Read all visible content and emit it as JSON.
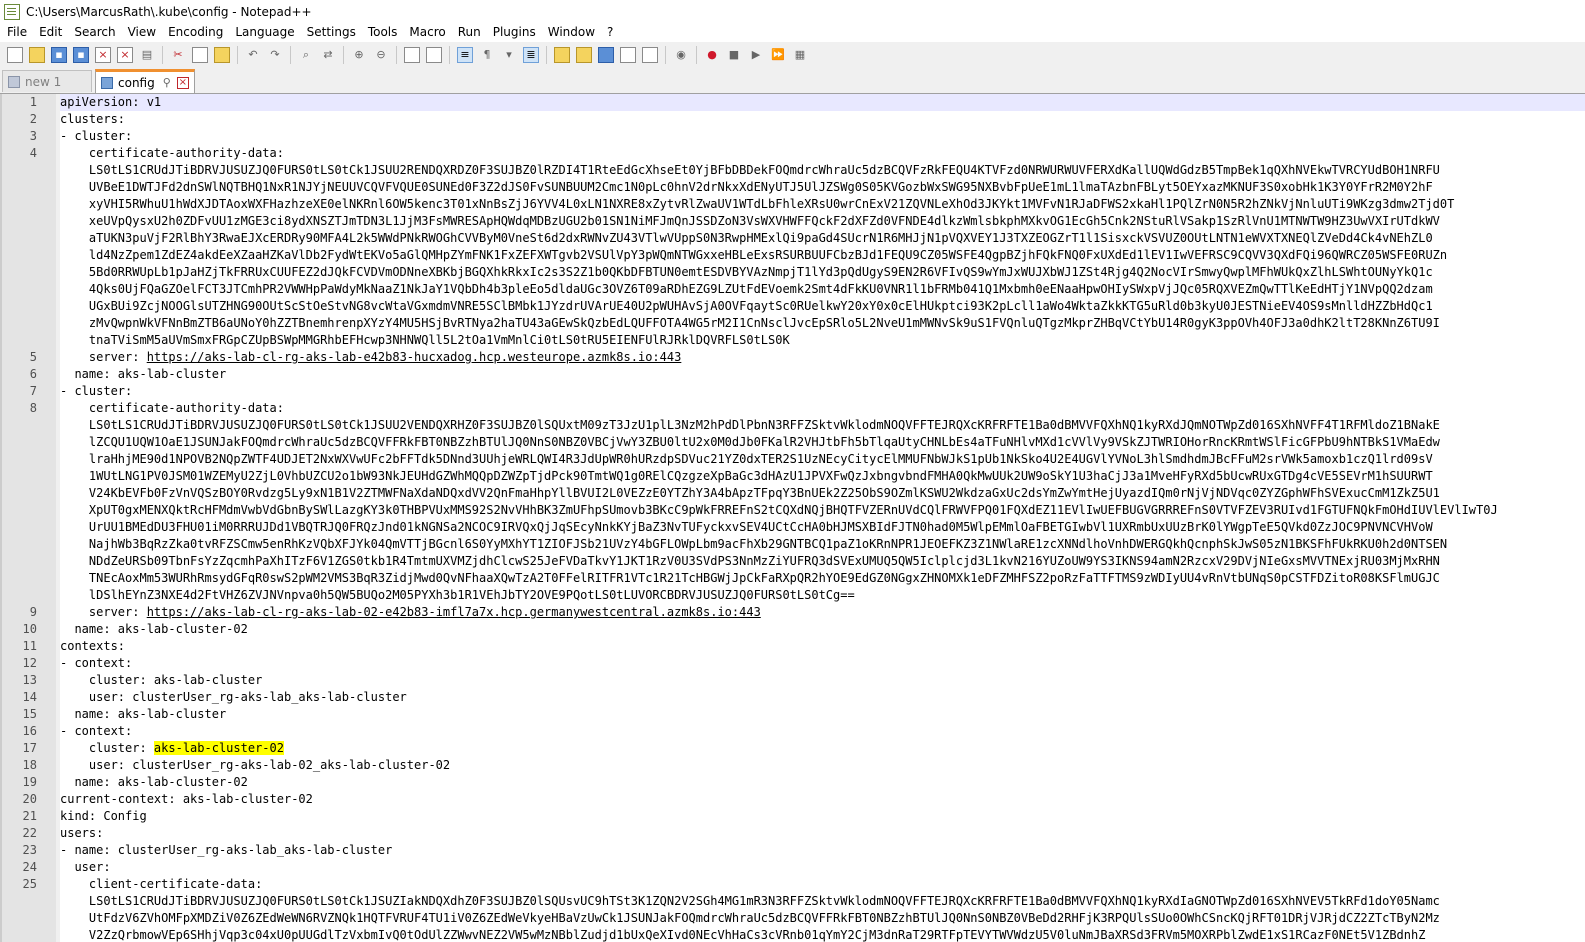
{
  "window": {
    "title": "C:\\Users\\MarcusRath\\.kube\\config - Notepad++"
  },
  "menu": [
    "File",
    "Edit",
    "Search",
    "View",
    "Encoding",
    "Language",
    "Settings",
    "Tools",
    "Macro",
    "Run",
    "Plugins",
    "Window",
    "?"
  ],
  "toolbar": {
    "icons": [
      "new-file-icon",
      "open-file-icon",
      "save-icon",
      "save-all-icon",
      "close-icon",
      "close-all-icon",
      "print-icon",
      "cut-icon",
      "copy-icon",
      "paste-icon",
      "undo-icon",
      "redo-icon",
      "find-icon",
      "replace-icon",
      "zoom-in-icon",
      "zoom-out-icon",
      "sync-vertical-icon",
      "sync-horizontal-icon",
      "word-wrap-icon",
      "all-characters-icon",
      "indent-guide-icon",
      "user-defined-language-icon",
      "document-map-icon",
      "function-list-icon",
      "folder-as-workspace-icon",
      "monitoring-icon",
      "record-macro-icon",
      "stop-recording-icon",
      "playback-macro-icon",
      "run-macro-multiple-icon",
      "save-macro-icon"
    ]
  },
  "tabs": [
    {
      "label": "new 1",
      "active": false
    },
    {
      "label": "config",
      "active": true
    }
  ],
  "editor": {
    "lines": [
      {
        "num": "1",
        "text": "apiVersion: v1"
      },
      {
        "num": "2",
        "text": "clusters:"
      },
      {
        "num": "3",
        "text": "- cluster:"
      },
      {
        "num": "4",
        "text": "    certificate-authority-data:"
      },
      {
        "num": "",
        "text": "    LS0tLS1CRUdJTiBDRVJUSUZJQ0FURS0tLS0tCk1JSUU2RENDQXRDZ0F3SUJBZ0lRZDI4T1RteEdGcXhseEt0YjBFbDBDekFOQmdrcWhraUc5dzBCQVFzRkFEQU4KTVFzd0NRWURWUVFERXdKallUQWdGdzB5TmpBek1qQXhNVEkwTVRCYUdBOH1NRFU"
      },
      {
        "num": "",
        "text": "    UVBeE1DWTJFd2dnSWlNQTBHQ1NxR1NJYjNEUUVCQVFVQUE0SUNEd0F3Z2dJS0FvSUNBUUM2Cmc1N0pLc0hnV2drNkxXdENyUTJ5UlJZSWg0S05KVGozbWxSWG95NXBvbFpUeE1mL1lmaTAzbnFBLyt5OEYxazMKNUF3S0xobHk1K3Y0YFrR2M0Y2hF"
      },
      {
        "num": "",
        "text": "    xyVHI5RWhuU1hWdXJDTAoxWXFHazhzeXE0elNKRnl6OW5kenc3T01xNnBsZjJ6YVV4L0xLN1NXRE8xZytvRlZwaUV1WTdLbFhleXRsU0wrCnExV21ZQVNLeXhOd3JKYkt1MVFvN1RJaDFWS2xkaHl1PQlZrN0N5R2hZNkVjNnluUTi9WKzg3dmw2Tjd0T"
      },
      {
        "num": "",
        "text": "    xeUVpQysxU2h0ZDFvUU1zMGE3ci8ydXNSZTJmTDN3L1JjM3FsMWRESApHQWdqMDBzUGU2b01SN1NiMFJmQnJSSDZoN3VsWXVHWFFQckF2dXFZd0VFNDE4dlkzWmlsbkphMXkvOG1EcGh5Cnk2NStuRlVSakp1SzRlVnU1MTNWTW9HZ3UwVXIrUTdkWV"
      },
      {
        "num": "",
        "text": "    aTUKN3puVjF2RlBhY3RwaEJXcERDRy90MFA4L2k5WWdPNkRWOGhCVVByM0VneSt6d2dxRWNvZU43VTlwVUppS0N3RwpHMExlQi9paGd4SUcrN1R6MHJjN1pVQXVEY1J3TXZEOGZrT1l1SisxckVSVUZ0OUtLNTN1eWVXTXNEQlZVeDd4Ck4vNEhZL0"
      },
      {
        "num": "",
        "text": "    ld4NzZpem1ZdEZ4akdEeXZaaHZKaVlDb2FydWtEKVo5aGlQMHpZYmFNK1FxZEFXWTgvb2VSUlVpY3pWQmNTWGxxeHBLeExsRSURBUUFCbzBJd1FEQU9CZ05WSFE4QgpBZjhFQkFNQ0FxUXdEd1lEV1IwVEFRSC9CQVV3QXdFQi96QWRCZ05WSFE0RUZn"
      },
      {
        "num": "",
        "text": "    5Bd0RRWUpLb1pJaHZjTkFRRUxCUUFEZ2dJQkFCVDVmODNneXBKbjBGQXhkRkxIc2s3S2Z1b0QKbDFBTUN0emtESDVBYVAzNmpjT1lYd3pQdUgyS9EN2R6VFIvQS9wYmJxWUJXbWJ1ZSt4Rjg4Q2NocVIrSmwyQwplMFhWUkQxZlhLSWhtOUNyYkQ1c"
      },
      {
        "num": "",
        "text": "    4Qks0UjFQaGZOelFCT3JTCmhPR2VWWHpPaWdyMkNaaZ1NkJaY1VQbDh4b3pleEo5dldaUGc3OVZ6T09aRDhEZG9LZUtFdEVoemk2Smt4dFkKU0VNR1l1bFRMb041Q1Mxbmh0eENaaHpwOHIySWxpVjJQc05RQXVEZmQwTTlKeEdHTjY1NVpQQ2dzam"
      },
      {
        "num": "",
        "text": "    UGxBUi9ZcjNOOGlsUTZHNG90OUtScStOeStvNG8vcWtaVGxmdmVNRE5SClBMbk1JYzdrUVArUE40U2pWUHAvSjA0OVFqaytSc0RUelkwY20xY0x0cElHUkptci93K2pLcll1aWo4WktaZkkKTG5uRld0b3kyU0JESTNieEV4OS9sMnlldHZZbHdQc1"
      },
      {
        "num": "",
        "text": "    zMvQwpnWkVFNnBmZTB6aUNoY0hZZTBnemhrenpXYzY4MU5HSjBvRTNya2haTU43aGEwSkQzbEdLQUFFOTA4WG5rM2I1CnNsclJvcEpSRlo5L2NveU1mMWNvSk9uS1FVQnluQTgzMkprZHBqVCtYbU14R0gyK3ppOVh4OFJ3a0dhK2ltT28KNnZ6TU9I"
      },
      {
        "num": "",
        "text": "    tnaTViSmM5aUVmSmxFRGpCZUpBSWpMMGRhbEFHcwp3NHNWQll5L2tOa1VmMnlCi0tLS0tRU5EIENFUlRJRklDQVRFLS0tLS0K"
      },
      {
        "num": "5",
        "text": "    server: https://aks-lab-cl-rg-aks-lab-e42b83-hucxadog.hcp.westeurope.azmk8s.io:443",
        "url": "https://aks-lab-cl-rg-aks-lab-e42b83-hucxadog.hcp.westeurope.azmk8s.io:443"
      },
      {
        "num": "6",
        "text": "  name: aks-lab-cluster"
      },
      {
        "num": "7",
        "text": "- cluster:"
      },
      {
        "num": "8",
        "text": "    certificate-authority-data:"
      },
      {
        "num": "",
        "text": "    LS0tLS1CRUdJTiBDRVJUSUZJQ0FURS0tLS0tCk1JSUU2VENDQXRHZ0F3SUJBZ0lSQUxtM09zT3JzU1plL3NzM2hPdDlPbnN3RFFZSktvWklodmNOQVFFTEJRQXcKRFRFTE1Ba0dBMVVFQXhNQ1kyRXdJQmNOTWpZd016SXhNVFF4T1RFMldoZ1BNakE"
      },
      {
        "num": "",
        "text": "    lZCQU1UQW1OaE1JSUNJakFOQmdrcWhraUc5dzBCQVFFRkFBT0NBZzhBTUlJQ0NnS0NBZ0VBCjVwY3ZBU0ltU2x0M0dJb0FKalR2VHJtbFh5bTlqaUtyCHNLbEs4aTFuNHlvMXd1cVVlVy9VSkZJTWRIOHorRncKRmtWSlFicGFPbU9hNTBkS1VMaEdw"
      },
      {
        "num": "",
        "text": "    lraHhjME90d1NPOVB2NQpZWTF4UDJET2NxWXVwUFc2bFFTdk5DNnd3UUhjeWRLQWI4R3JdUpWR0hURzdpSDVuc21YZ0dxTER2S1UzNEcyCitycElMMUFNbWJkS1pUb1NkSko4U2E4UGVlYVNoL3hlSmdhdmJBcFFuM2srVWk5amoxb1czQ1lrd09sV"
      },
      {
        "num": "",
        "text": "    1WUtLNG1PV0JSM01WZEMyU2ZjL0VhbUZCU2o1bW93NkJEUHdGZWhMQQpDZWZpTjdPck90TmtWQ1g0RElCQzgzeXpBaGc3dHAzU1JPVXFwQzJxbngvbndFMHA0QkMwUUk2UW9oSkY1U3haCjJ3a1MveHFyRXd5bUcwRUxGTDg4cVE5SEVrM1hSUURWT"
      },
      {
        "num": "",
        "text": "    V24KbEVFb0FzVnVQSzBOY0Rvdzg5Ly9xN1B1V2ZTMWFNaXdaNDQxdVV2QnFmaHhpYllBVUI2L0VEZzE0YTZhY3A4bApzTFpqY3BnUEk2Z25ObS9OZmlKSWU2WkdzaGxUc2dsYmZwYmtHejUyazdIQm0rNjVjNDVqc0ZYZGphWFhSVExucCmM1ZkZ5U1"
      },
      {
        "num": "",
        "text": "    XpUT0gxMENXQktRcHFMdmVwbVdGbnBySWlLazgKY3k0THBPVUxMMS92S2NvVHhBK3ZmUFhpSUmovb3BKcC9pWkFRREFnS2tCQXdNQjBHQTFVZERnUVdCQlFRWVFPQ01FQXdEZ11EVlIwUEFBUGVGRRREFnS0VTVFZEV3RUIvd1FGTUFNQkFmOHdIUVlEVlIwT0J"
      },
      {
        "num": "",
        "text": "    UrUU1BMEdDU3FHU01iM0RRRUJDd1VBQTRJQ0FRQzJnd01kNGNSa2NCOC9IRVQxQjJqSEcyNnkKYjBaZ3NvTUFyckxvSEV4UCtCcHA0bHJMSXBIdFJTN0had0M5WlpEMmlOaFBETGIwbVl1UXRmbUxUUzBrK0lYWgpTeE5QVkd0ZzJOC9PNVNCVHVoW"
      },
      {
        "num": "",
        "text": "    NajhWb3BqRzZka0tvRFZSCmw5enRhKzVQbXFJYk04QmVTTjBGcnl6S0YyMXhYT1ZIOFJSb21UVzY4bGFLOWpLbm9acFhXb29GNTBCQ1paZ1oKRnNPR1JEOEFKZ3Z1NWlaRE1zcXNNdlhoVnhDWERGQkhQcnphSkJwS05zN1BKSFhFUkRKU0h2d0NTSEN"
      },
      {
        "num": "",
        "text": "    NDdZeURSb09TbnFsYzZqcmhPaXhITzF6V1ZGS0tkb1R4TmtmUXVMZjdhClcwS25JeFVDaTkvY1JKT1RzV0U3SVdPS3NnMzZiYUFRQ3dSVExUMUQ5QW5Iclplcjd3L1kvN216YUZoUW9YS3IKNS94amN2RzcxV29DVjNIeGxsMVVTNExjRU03MjMxRHN"
      },
      {
        "num": "",
        "text": "    TNEcAoxMm53WURhRmsydGFqR0swS2pWM2VMS3BqR3ZidjMwd0QvNFhaaXQwTzA2T0FFelRITFR1VTc1R21TcHBGWjJpCkFaRXpQR2hYOE9EdGZ0NGgxZHNOMXk1eDFZMHFSZ2poRzFaTTFTMS9zWDIyUU4vRnVtbUNqS0pCSTFDZitoR08KSFlmUGJC"
      },
      {
        "num": "",
        "text": "    lDSlhEYnZ3NXE4d2FtVHZ6ZVJNVnpva0h5QW5BUQo2M05PYXh3b1R1VEhJbTY2OVE9PQotLS0tLUVORCBDRVJUSUZJQ0FURS0tLS0tCg=="
      },
      {
        "num": "9",
        "text": "    server: https://aks-lab-cl-rg-aks-lab-02-e42b83-imfl7a7x.hcp.germanywestcentral.azmk8s.io:443",
        "url": "https://aks-lab-cl-rg-aks-lab-02-e42b83-imfl7a7x.hcp.germanywestcentral.azmk8s.io:443"
      },
      {
        "num": "10",
        "text": "  name: aks-lab-cluster-02"
      },
      {
        "num": "11",
        "text": "contexts:"
      },
      {
        "num": "12",
        "text": "- context:"
      },
      {
        "num": "13",
        "text": "    cluster: aks-lab-cluster"
      },
      {
        "num": "14",
        "text": "    user: clusterUser_rg-aks-lab_aks-lab-cluster"
      },
      {
        "num": "15",
        "text": "  name: aks-lab-cluster"
      },
      {
        "num": "16",
        "text": "- context:"
      },
      {
        "num": "17",
        "text": "    cluster: aks-lab-cluster-02",
        "highlight": "aks-lab-cluster-02"
      },
      {
        "num": "18",
        "text": "    user: clusterUser_rg-aks-lab-02_aks-lab-cluster-02"
      },
      {
        "num": "19",
        "text": "  name: aks-lab-cluster-02"
      },
      {
        "num": "20",
        "text": "current-context: aks-lab-cluster-02"
      },
      {
        "num": "21",
        "text": "kind: Config"
      },
      {
        "num": "22",
        "text": "users:"
      },
      {
        "num": "23",
        "text": "- name: clusterUser_rg-aks-lab_aks-lab-cluster"
      },
      {
        "num": "24",
        "text": "  user:"
      },
      {
        "num": "25",
        "text": "    client-certificate-data:"
      },
      {
        "num": "",
        "text": "    LS0tLS1CRUdJTiBDRVJUSUZJQ0FURS0tLS0tCk1JSUZIakNDQXdhZ0F3SUJBZ0lSQUsvUC9hTSt3K1ZQN2V2SGh4MG1mR3N3RFFZSktvWklodmNOQVFFTEJRQXcKRFRFTE1Ba0dBMVVFQXhNQ1kyRXdIaGNOTWpZd016SXhNVEV5TkRFd1doY05Namc"
      },
      {
        "num": "",
        "text": "    UtFdzV6ZVhOMFpXMDZiV0Z6ZEdWeWN6RVZNQk1HQTFVRUF4TU1iV0Z6ZEdWeVkyeHBaVzUwCk1JSUNJakFOQmdrcWhraUc5dzBCQVFFRkFBT0NBZzhBTUlJQ0NnS0NBZ0VBeDd2RHFjK3RPQUlsSUo0OWhCSncKQjRFT01DRjVJRjdCZ2ZTcTByN2Mz"
      },
      {
        "num": "",
        "text": "    V2ZzQrbmowVEp6SHhjVqp3c04xU0pUUGdlTzVxbmIvQ0tOdUlZZWwvNEZ2VW5wMzNBblZudjd1bUxQeXIvd0NEcVhHaCs3cVRnb01qYmY2CjM3dnRaT29RTFpTEVYTWVWdzU5V0luNmJBaXRSd3FRVm5MOXRPblZwdE1xS1RCazF0NEt5V1ZBdnhZ"
      }
    ]
  }
}
